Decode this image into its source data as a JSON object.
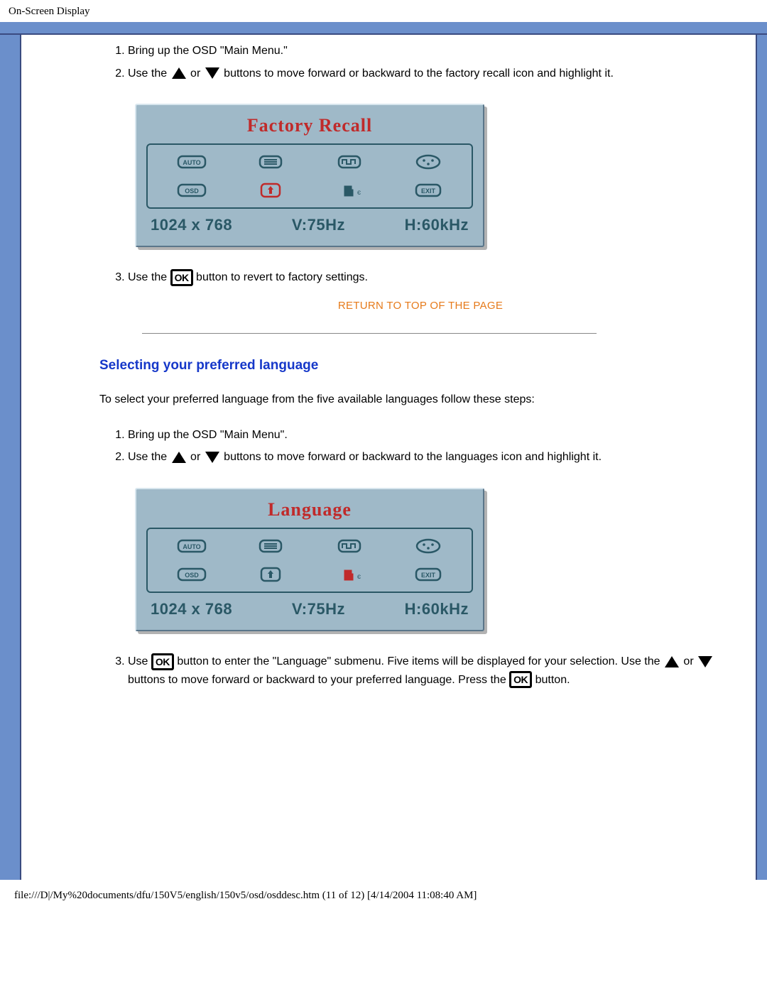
{
  "header": {
    "title": "On-Screen Display"
  },
  "section1": {
    "list": {
      "item1": "Bring up the OSD \"Main Menu.\"",
      "item2_a": "Use the ",
      "item2_b": " or ",
      "item2_c": " buttons to move forward or backward to the factory recall icon and highlight it.",
      "item3_a": "Use the ",
      "item3_b": " button to revert to factory settings."
    },
    "osd": {
      "title": "Factory Recall",
      "resolution": "1024 x 768",
      "vfreq": "V:75Hz",
      "hfreq": "H:60kHz",
      "highlight_index": 5
    }
  },
  "return_link": "RETURN TO TOP OF THE PAGE",
  "section2": {
    "heading": "Selecting your preferred language",
    "intro": "To select your preferred language from the five available languages follow these steps:",
    "list": {
      "item1": "Bring up the OSD \"Main Menu\".",
      "item2_a": "Use the ",
      "item2_b": " or ",
      "item2_c": " buttons to move forward or backward to the languages icon and highlight it.",
      "item3_a": "Use ",
      "item3_b": " button to enter the \"Language\" submenu. Five items will be displayed for your selection. Use the ",
      "item3_c": " or ",
      "item3_d": " buttons to move forward or backward to your preferred language. Press the ",
      "item3_e": " button."
    },
    "osd": {
      "title": "Language",
      "resolution": "1024 x 768",
      "vfreq": "V:75Hz",
      "hfreq": "H:60kHz",
      "highlight_index": 6
    }
  },
  "icons": {
    "ok_label": "OK",
    "row1": [
      "auto-icon",
      "menu-icon",
      "signal-icon",
      "color-icon"
    ],
    "row2": [
      "osd-icon",
      "recall-icon",
      "language-icon",
      "exit-icon"
    ],
    "labels": {
      "auto": "AUTO",
      "osd": "OSD",
      "exit": "EXIT"
    }
  },
  "footer": {
    "text": "file:///D|/My%20documents/dfu/150V5/english/150v5/osd/osddesc.htm (11 of 12) [4/14/2004 11:08:40 AM]"
  }
}
